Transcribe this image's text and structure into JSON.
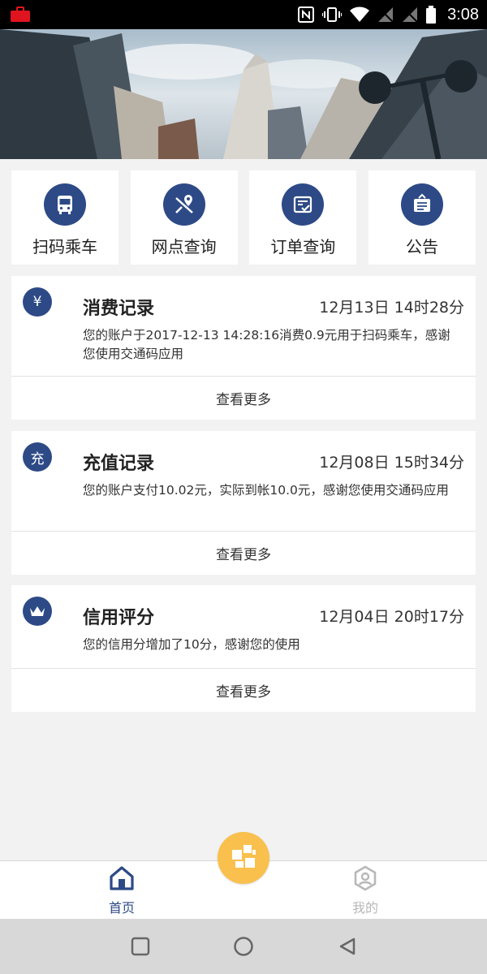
{
  "status_bar": {
    "time": "3:08",
    "icons": [
      "briefcase-icon",
      "nfc-icon",
      "vibrate-icon",
      "wifi-icon",
      "signal-off-icon",
      "signal-off-icon",
      "battery-icon"
    ]
  },
  "banner": {
    "image": "city-skyscrapers-photo"
  },
  "actions": [
    {
      "label": "扫码乘车",
      "icon": "bus-icon"
    },
    {
      "label": "网点查询",
      "icon": "map-pin-icon"
    },
    {
      "label": "订单查询",
      "icon": "order-icon"
    },
    {
      "label": "公告",
      "icon": "notice-board-icon"
    }
  ],
  "cards": [
    {
      "badge": "¥",
      "title": "消费记录",
      "time": "12月13日 14时28分",
      "desc": "您的账户于2017-12-13 14:28:16消费0.9元用于扫码乘车，感谢您使用交通码应用",
      "more": "查看更多"
    },
    {
      "badge": "充",
      "title": "充值记录",
      "time": "12月08日 15时34分",
      "desc": "您的账户支付10.02元，实际到帐10.0元，感谢您使用交通码应用",
      "more": "查看更多"
    },
    {
      "badge": "crown-icon",
      "title": "信用评分",
      "time": "12月04日 20时17分",
      "desc": "您的信用分增加了10分，感谢您的使用",
      "more": "查看更多"
    }
  ],
  "tabbar": {
    "home": "首页",
    "mine": "我的",
    "center": "qr-scan-icon"
  },
  "colors": {
    "accent": "#2d4a86",
    "center_button": "#f9c04d",
    "inactive": "#b8b8b8"
  }
}
